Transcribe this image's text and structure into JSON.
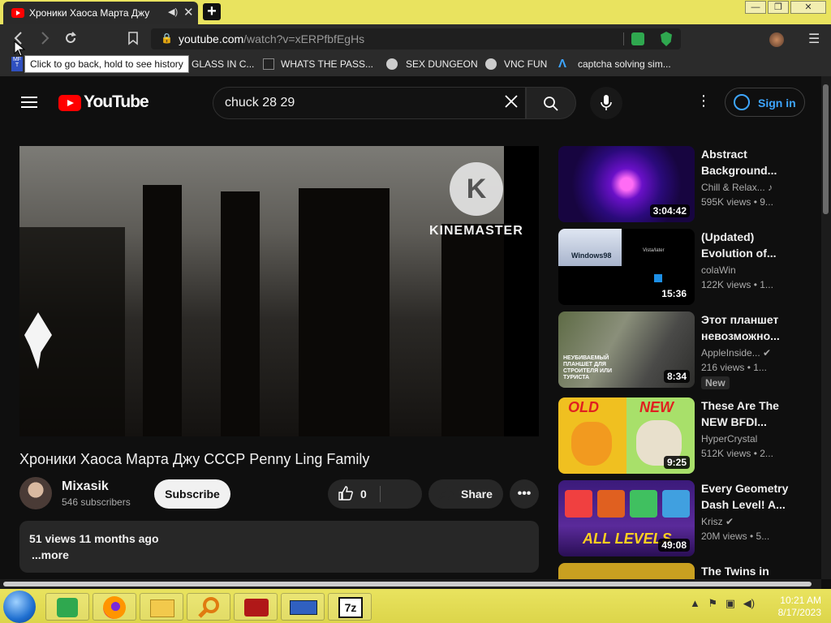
{
  "browser": {
    "tab_title": "Хроники Хаоса Марта Джу С",
    "tab_speaker": "◀)",
    "tab_close": "✕",
    "new_tab": "+",
    "win_min": "—",
    "win_max": "❐",
    "win_close": "✕",
    "url_host": "youtube.com",
    "url_path": "/watch?v=xERPfbfEgHs",
    "tooltip": "Click to go back, hold to see history",
    "bookmarks": [
      {
        "label": "GLASS IN C..."
      },
      {
        "label": "WHATS THE PASS..."
      },
      {
        "label": "SEX DUNGEON"
      },
      {
        "label": "VNC FUN"
      },
      {
        "label": "captcha solving sim..."
      }
    ]
  },
  "youtube": {
    "logo_text": "YouTube",
    "search_query": "chuck 28 29",
    "sign_in": "Sign in",
    "watermark": "KINEMASTER",
    "watermark_k": "K",
    "video_title": "Хроники Хаоса Марта Джу СССР Penny Ling Family",
    "channel_name": "Mixasik",
    "channel_subs": "546 subscribers",
    "subscribe_label": "Subscribe",
    "like_count": "0",
    "share_label": "Share",
    "more_label": "•••",
    "description_stats": "51 views  11 months ago",
    "description_more": "...more",
    "recommendations": [
      {
        "title": "Abstract Background...",
        "channel": "Chill & Relax... ♪",
        "views": "595K views  • 9...",
        "duration": "3:04:42"
      },
      {
        "title": "(Updated) Evolution of...",
        "channel": "colaWin",
        "views": "122K views  • 1...",
        "duration": "15:36"
      },
      {
        "title": "Этот планшет невозможно...",
        "channel": "AppleInside... ✔",
        "views": "216 views  • 1...",
        "duration": "8:34",
        "badge": "New",
        "thumb_text": "НЕУБИВАЕМЫЙ ПЛАНШЕТ ДЛЯ СТРОИТЕЛЯ ИЛИ ТУРИСТА"
      },
      {
        "title": "These Are The NEW BFDI...",
        "channel": "HyperCrystal",
        "views": "512K views  • 2...",
        "duration": "9:25",
        "thumb_old": "OLD",
        "thumb_new": "NEW"
      },
      {
        "title": "Every Geometry Dash Level! A...",
        "channel": "Krisz ✔",
        "views": "20M views  • 5...",
        "duration": "49:08",
        "thumb_text": "ALL LEVELS"
      },
      {
        "title": "The Twins in",
        "channel": "",
        "views": "",
        "duration": ""
      }
    ],
    "thumb_win98": "Windows98",
    "thumb_vista": "Vista/later"
  },
  "taskbar": {
    "clock_time": "10:21 AM",
    "clock_date": "8/17/2023",
    "app_7z": "7z"
  },
  "colors": {
    "accent_yellow": "#e9e35f",
    "yt_red": "#ff0000",
    "link_blue": "#3ea6ff"
  }
}
